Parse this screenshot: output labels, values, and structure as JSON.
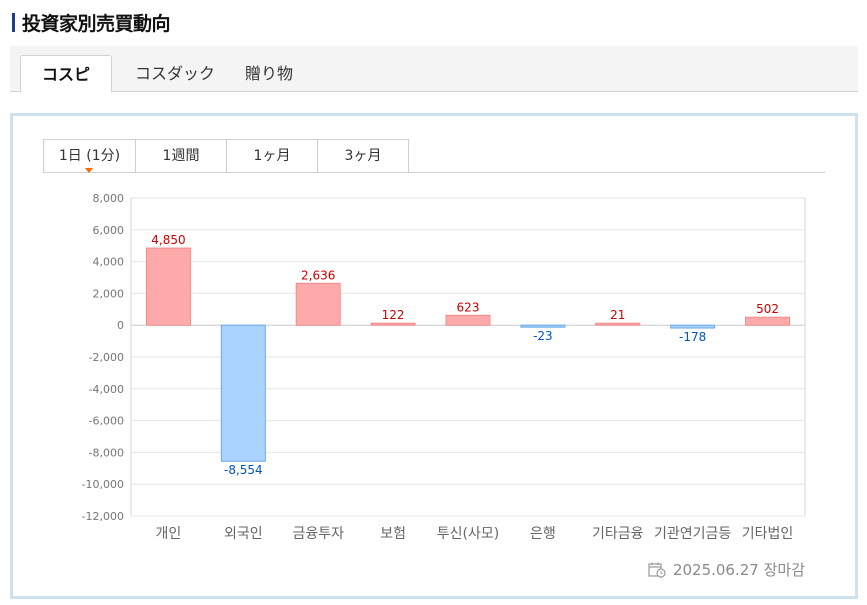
{
  "header": {
    "title": "投資家別売買動向"
  },
  "market_tabs": [
    {
      "label": "コスピ",
      "active": true
    },
    {
      "label": "コスダック",
      "active": false
    },
    {
      "label": "贈り物",
      "active": false
    }
  ],
  "period_tabs": [
    {
      "label": "1日 (1分)",
      "active": true
    },
    {
      "label": "1週間",
      "active": false
    },
    {
      "label": "1ヶ月",
      "active": false
    },
    {
      "label": "3ヶ月",
      "active": false
    }
  ],
  "colors": {
    "positive_fill": "#ffaaaa",
    "positive_stroke": "#f08c8c",
    "negative_fill": "#aad2ff",
    "negative_stroke": "#6aaae8",
    "positive_label": "#cc0000",
    "negative_label": "#0055bb",
    "panel_border": "#cfe0ef",
    "accent": "#ff6a00"
  },
  "chart_data": {
    "type": "bar",
    "categories": [
      "개인",
      "외국인",
      "금융투자",
      "보험",
      "투신(사모)",
      "은행",
      "기타금융",
      "기관연기금등",
      "기타법인"
    ],
    "values": [
      4850,
      -8554,
      2636,
      122,
      623,
      -23,
      21,
      -178,
      502
    ],
    "value_labels": [
      "4,850",
      "-8,554",
      "2,636",
      "122",
      "623",
      "-23",
      "21",
      "-178",
      "502"
    ],
    "y_ticks": [
      8000,
      6000,
      4000,
      2000,
      0,
      -2000,
      -4000,
      -6000,
      -8000,
      -10000,
      -12000
    ],
    "y_tick_labels": [
      "8,000",
      "6,000",
      "4,000",
      "2,000",
      "0",
      "-2,000",
      "-4,000",
      "-6,000",
      "-8,000",
      "-10,000",
      "-12,000"
    ],
    "ylim": [
      -12000,
      8000
    ],
    "grid": true,
    "title": "",
    "xlabel": "",
    "ylabel": ""
  },
  "footer": {
    "timestamp": "2025.06.27 장마감",
    "icon": "calendar-clock-icon"
  }
}
